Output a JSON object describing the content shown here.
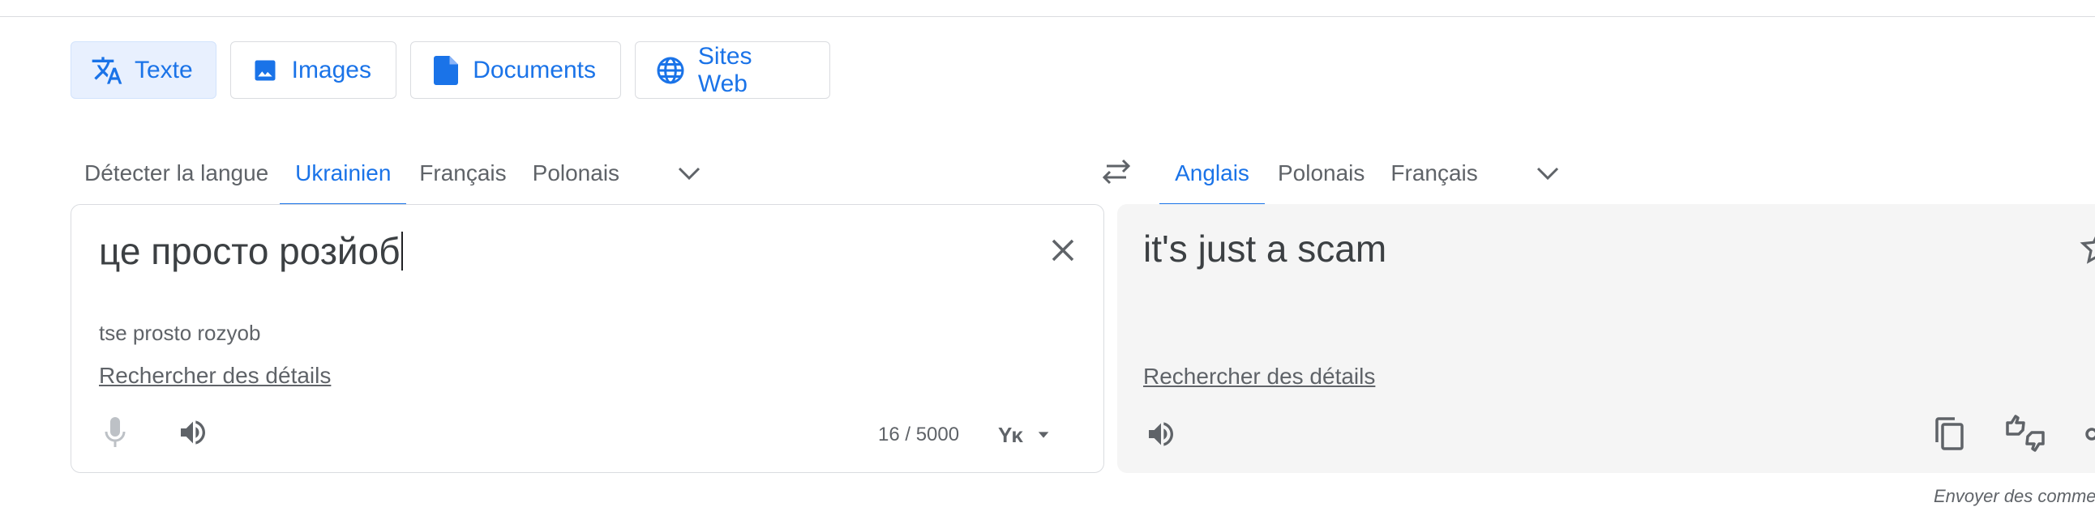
{
  "modes": [
    {
      "label": "Texte",
      "icon": "translate-icon",
      "active": true
    },
    {
      "label": "Images",
      "icon": "image-icon"
    },
    {
      "label": "Documents",
      "icon": "document-icon"
    },
    {
      "label": "Sites Web",
      "icon": "globe-icon"
    }
  ],
  "source_langs": [
    "Détecter la langue",
    "Ukrainien",
    "Français",
    "Polonais"
  ],
  "source_active": "Ukrainien",
  "target_langs": [
    "Anglais",
    "Polonais",
    "Français"
  ],
  "target_active": "Anglais",
  "source": {
    "text": "це просто розйоб",
    "transliteration": "tse prosto rozyob",
    "details_link": "Rechercher des détails",
    "char_count": "16 / 5000"
  },
  "target": {
    "text": "it's just a scam",
    "details_link": "Rechercher des détails"
  },
  "feedback_link": "Envoyer des comme",
  "colors": {
    "accent": "#1a73e8",
    "active_bg": "#e8f0fe",
    "panel_bg": "#f5f5f5",
    "icon": "#5f6368"
  }
}
